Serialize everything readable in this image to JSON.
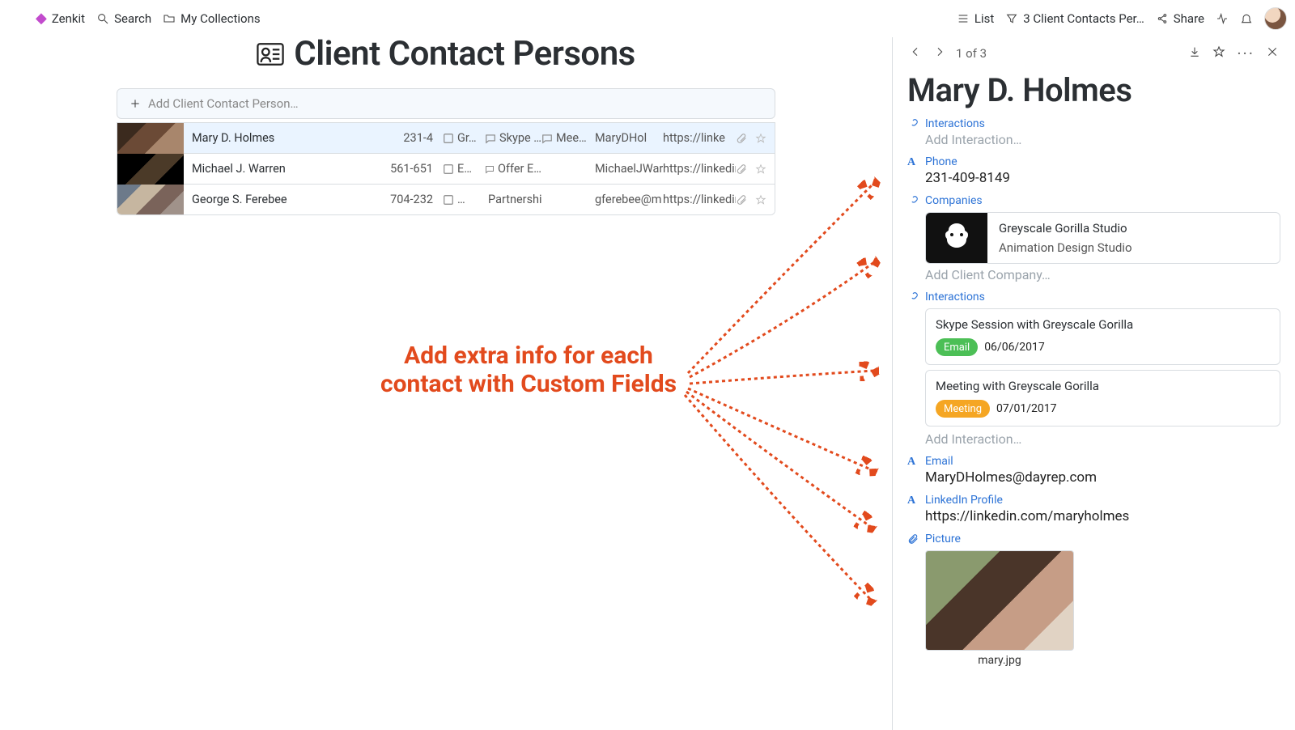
{
  "topbar": {
    "app_name": "Zenkit",
    "search_label": "Search",
    "collections_label": "My Collections",
    "view_label": "List",
    "filter_label": "3 Client Contacts Per…",
    "share_label": "Share"
  },
  "page": {
    "title": "Client Contact Persons",
    "add_placeholder": "Add Client Contact Person…"
  },
  "rows": [
    {
      "name": "Mary D. Holmes",
      "phone": "231-4",
      "company": "Gr…",
      "int1": "Skype …",
      "int2": "Mee…",
      "email": "MaryDHol",
      "url": "https://linke",
      "selected": true
    },
    {
      "name": "Michael J. Warren",
      "phone": "561-651",
      "company": "E…",
      "int1": "Offer E…",
      "int2": "",
      "email": "MichaelJWarren",
      "url": "https://linkedin",
      "selected": false
    },
    {
      "name": "George S. Ferebee",
      "phone": "704-232",
      "company": "…",
      "int1": "Partnership …",
      "int2": "",
      "email": "gferebee@m",
      "url": "https://linkedin",
      "selected": false
    }
  ],
  "callout": {
    "line1": "Add extra info for each",
    "line2": "contact with Custom Fields"
  },
  "detail": {
    "pager": "1 of 3",
    "name": "Mary D. Holmes",
    "fields": {
      "interactions_label": "Interactions",
      "add_interaction_ph": "Add Interaction…",
      "phone_label": "Phone",
      "phone_value": "231-409-8149",
      "companies_label": "Companies",
      "company_name": "Greyscale Gorilla Studio",
      "company_sub": "Animation Design Studio",
      "add_company_ph": "Add Client Company…",
      "interactions2_label": "Interactions",
      "inter1_text": "Skype Session with Greyscale Gorilla",
      "inter1_chip": "Email",
      "inter1_date": "06/06/2017",
      "inter2_text": "Meeting with Greyscale Gorilla",
      "inter2_chip": "Meeting",
      "inter2_date": "07/01/2017",
      "email_label": "Email",
      "email_value": "MaryDHolmes@dayrep.com",
      "linkedin_label": "LinkedIn Profile",
      "linkedin_value": "https://linkedin.com/maryholmes",
      "picture_label": "Picture",
      "picture_caption": "mary.jpg"
    }
  }
}
